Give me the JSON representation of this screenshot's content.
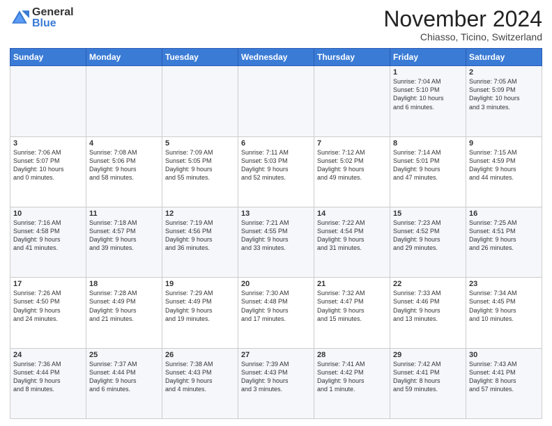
{
  "logo": {
    "general": "General",
    "blue": "Blue"
  },
  "header": {
    "month": "November 2024",
    "location": "Chiasso, Ticino, Switzerland"
  },
  "weekdays": [
    "Sunday",
    "Monday",
    "Tuesday",
    "Wednesday",
    "Thursday",
    "Friday",
    "Saturday"
  ],
  "rows": [
    [
      {
        "day": "",
        "info": ""
      },
      {
        "day": "",
        "info": ""
      },
      {
        "day": "",
        "info": ""
      },
      {
        "day": "",
        "info": ""
      },
      {
        "day": "",
        "info": ""
      },
      {
        "day": "1",
        "info": "Sunrise: 7:04 AM\nSunset: 5:10 PM\nDaylight: 10 hours\nand 6 minutes."
      },
      {
        "day": "2",
        "info": "Sunrise: 7:05 AM\nSunset: 5:09 PM\nDaylight: 10 hours\nand 3 minutes."
      }
    ],
    [
      {
        "day": "3",
        "info": "Sunrise: 7:06 AM\nSunset: 5:07 PM\nDaylight: 10 hours\nand 0 minutes."
      },
      {
        "day": "4",
        "info": "Sunrise: 7:08 AM\nSunset: 5:06 PM\nDaylight: 9 hours\nand 58 minutes."
      },
      {
        "day": "5",
        "info": "Sunrise: 7:09 AM\nSunset: 5:05 PM\nDaylight: 9 hours\nand 55 minutes."
      },
      {
        "day": "6",
        "info": "Sunrise: 7:11 AM\nSunset: 5:03 PM\nDaylight: 9 hours\nand 52 minutes."
      },
      {
        "day": "7",
        "info": "Sunrise: 7:12 AM\nSunset: 5:02 PM\nDaylight: 9 hours\nand 49 minutes."
      },
      {
        "day": "8",
        "info": "Sunrise: 7:14 AM\nSunset: 5:01 PM\nDaylight: 9 hours\nand 47 minutes."
      },
      {
        "day": "9",
        "info": "Sunrise: 7:15 AM\nSunset: 4:59 PM\nDaylight: 9 hours\nand 44 minutes."
      }
    ],
    [
      {
        "day": "10",
        "info": "Sunrise: 7:16 AM\nSunset: 4:58 PM\nDaylight: 9 hours\nand 41 minutes."
      },
      {
        "day": "11",
        "info": "Sunrise: 7:18 AM\nSunset: 4:57 PM\nDaylight: 9 hours\nand 39 minutes."
      },
      {
        "day": "12",
        "info": "Sunrise: 7:19 AM\nSunset: 4:56 PM\nDaylight: 9 hours\nand 36 minutes."
      },
      {
        "day": "13",
        "info": "Sunrise: 7:21 AM\nSunset: 4:55 PM\nDaylight: 9 hours\nand 33 minutes."
      },
      {
        "day": "14",
        "info": "Sunrise: 7:22 AM\nSunset: 4:54 PM\nDaylight: 9 hours\nand 31 minutes."
      },
      {
        "day": "15",
        "info": "Sunrise: 7:23 AM\nSunset: 4:52 PM\nDaylight: 9 hours\nand 29 minutes."
      },
      {
        "day": "16",
        "info": "Sunrise: 7:25 AM\nSunset: 4:51 PM\nDaylight: 9 hours\nand 26 minutes."
      }
    ],
    [
      {
        "day": "17",
        "info": "Sunrise: 7:26 AM\nSunset: 4:50 PM\nDaylight: 9 hours\nand 24 minutes."
      },
      {
        "day": "18",
        "info": "Sunrise: 7:28 AM\nSunset: 4:49 PM\nDaylight: 9 hours\nand 21 minutes."
      },
      {
        "day": "19",
        "info": "Sunrise: 7:29 AM\nSunset: 4:49 PM\nDaylight: 9 hours\nand 19 minutes."
      },
      {
        "day": "20",
        "info": "Sunrise: 7:30 AM\nSunset: 4:48 PM\nDaylight: 9 hours\nand 17 minutes."
      },
      {
        "day": "21",
        "info": "Sunrise: 7:32 AM\nSunset: 4:47 PM\nDaylight: 9 hours\nand 15 minutes."
      },
      {
        "day": "22",
        "info": "Sunrise: 7:33 AM\nSunset: 4:46 PM\nDaylight: 9 hours\nand 13 minutes."
      },
      {
        "day": "23",
        "info": "Sunrise: 7:34 AM\nSunset: 4:45 PM\nDaylight: 9 hours\nand 10 minutes."
      }
    ],
    [
      {
        "day": "24",
        "info": "Sunrise: 7:36 AM\nSunset: 4:44 PM\nDaylight: 9 hours\nand 8 minutes."
      },
      {
        "day": "25",
        "info": "Sunrise: 7:37 AM\nSunset: 4:44 PM\nDaylight: 9 hours\nand 6 minutes."
      },
      {
        "day": "26",
        "info": "Sunrise: 7:38 AM\nSunset: 4:43 PM\nDaylight: 9 hours\nand 4 minutes."
      },
      {
        "day": "27",
        "info": "Sunrise: 7:39 AM\nSunset: 4:43 PM\nDaylight: 9 hours\nand 3 minutes."
      },
      {
        "day": "28",
        "info": "Sunrise: 7:41 AM\nSunset: 4:42 PM\nDaylight: 9 hours\nand 1 minute."
      },
      {
        "day": "29",
        "info": "Sunrise: 7:42 AM\nSunset: 4:41 PM\nDaylight: 8 hours\nand 59 minutes."
      },
      {
        "day": "30",
        "info": "Sunrise: 7:43 AM\nSunset: 4:41 PM\nDaylight: 8 hours\nand 57 minutes."
      }
    ]
  ]
}
